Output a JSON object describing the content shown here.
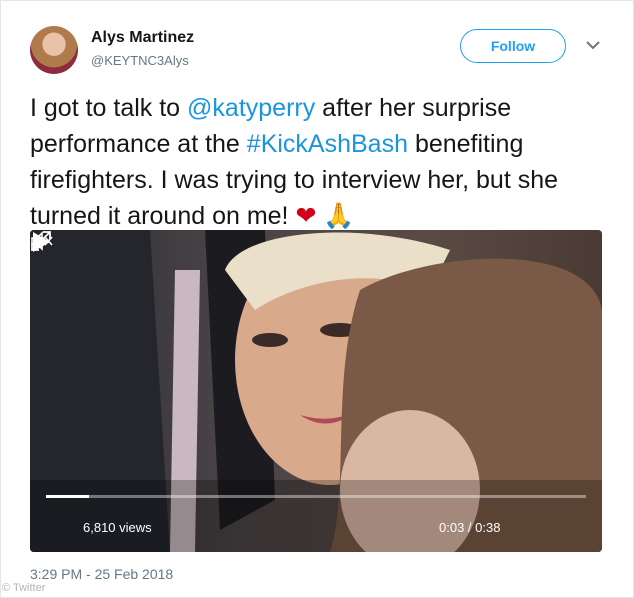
{
  "author": {
    "name": "Alys Martinez",
    "handle": "@KEYTNC3Alys"
  },
  "follow_button": {
    "label": "Follow"
  },
  "tweet": {
    "text_1": "I got to talk to ",
    "mention": "@katyperry",
    "text_2": " after her surprise performance at the ",
    "hashtag": "#KickAshBash",
    "text_3": " benefiting firefighters. I was trying to interview her, but she turned it around on me! ",
    "emoji_heart": "❤",
    "emoji_pray": "🙏"
  },
  "video": {
    "views": "6,810 views",
    "time": "0:03 / 0:38",
    "progress": 0.08
  },
  "timestamp": "3:29 PM - 25 Feb 2018",
  "credit": "© Twitter",
  "colors": {
    "accent": "#1da1f2",
    "link": "#1b95e0",
    "muted": "#657786"
  }
}
